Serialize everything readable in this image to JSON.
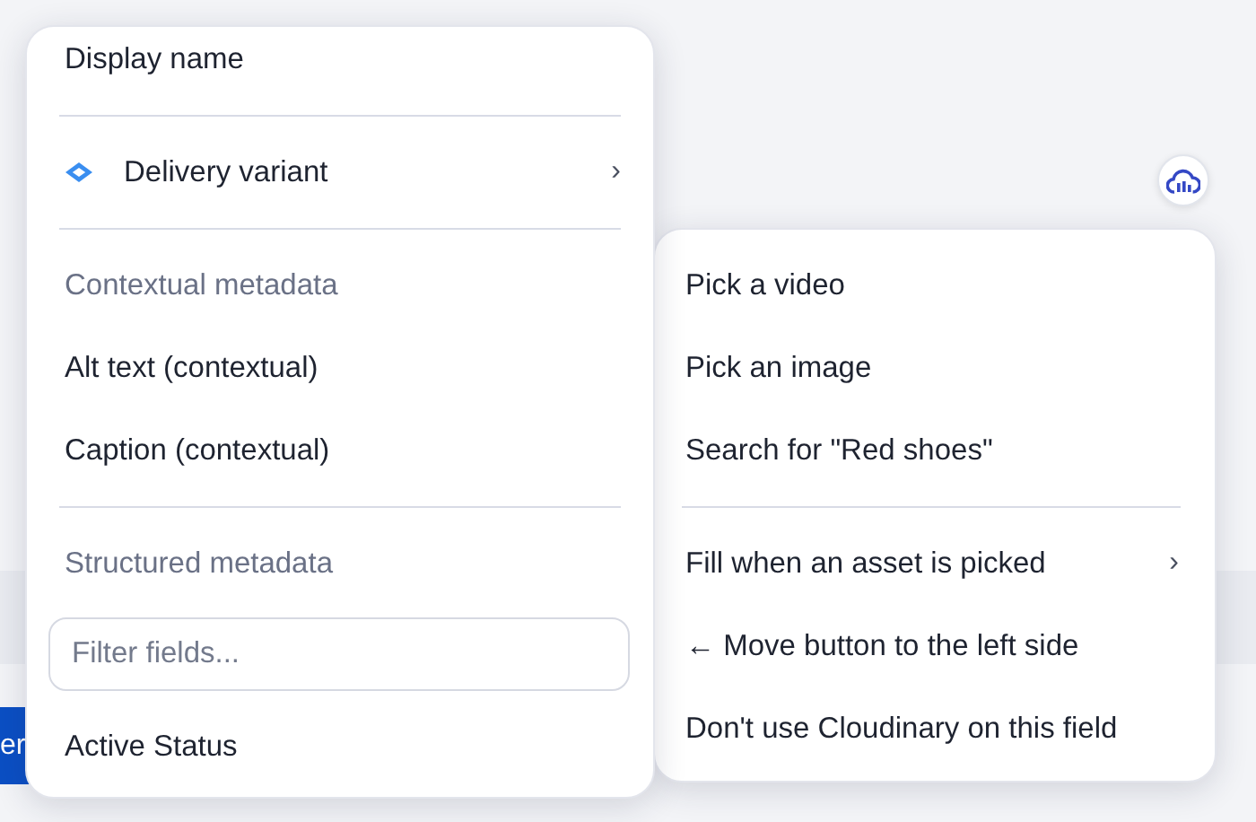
{
  "background_button": {
    "label": "er"
  },
  "field_menu": {
    "items": [
      {
        "kind": "item",
        "label": "Display name"
      },
      {
        "kind": "divider"
      },
      {
        "kind": "submenu",
        "label": "Delivery variant",
        "chevron": "›"
      },
      {
        "kind": "divider"
      },
      {
        "kind": "header",
        "label": "Contextual metadata"
      },
      {
        "kind": "item",
        "label": "Alt text (contextual)"
      },
      {
        "kind": "item",
        "label": "Caption (contextual)"
      },
      {
        "kind": "divider"
      },
      {
        "kind": "header",
        "label": "Structured metadata"
      },
      {
        "kind": "field",
        "placeholder": "Filter fields..."
      },
      {
        "kind": "item",
        "label": "Active Status"
      }
    ]
  },
  "cloudinary_menu": {
    "items": [
      {
        "kind": "item",
        "label": "Pick a video"
      },
      {
        "kind": "item",
        "label": "Pick an image"
      },
      {
        "kind": "item",
        "label": "Search for \"Red shoes\""
      },
      {
        "kind": "divider"
      },
      {
        "kind": "submenu",
        "label": "Fill when an asset is picked",
        "chevron": "›"
      },
      {
        "kind": "item",
        "label": "← Move button to the left side"
      },
      {
        "kind": "item",
        "label": "Don't use Cloudinary on this field"
      }
    ]
  }
}
